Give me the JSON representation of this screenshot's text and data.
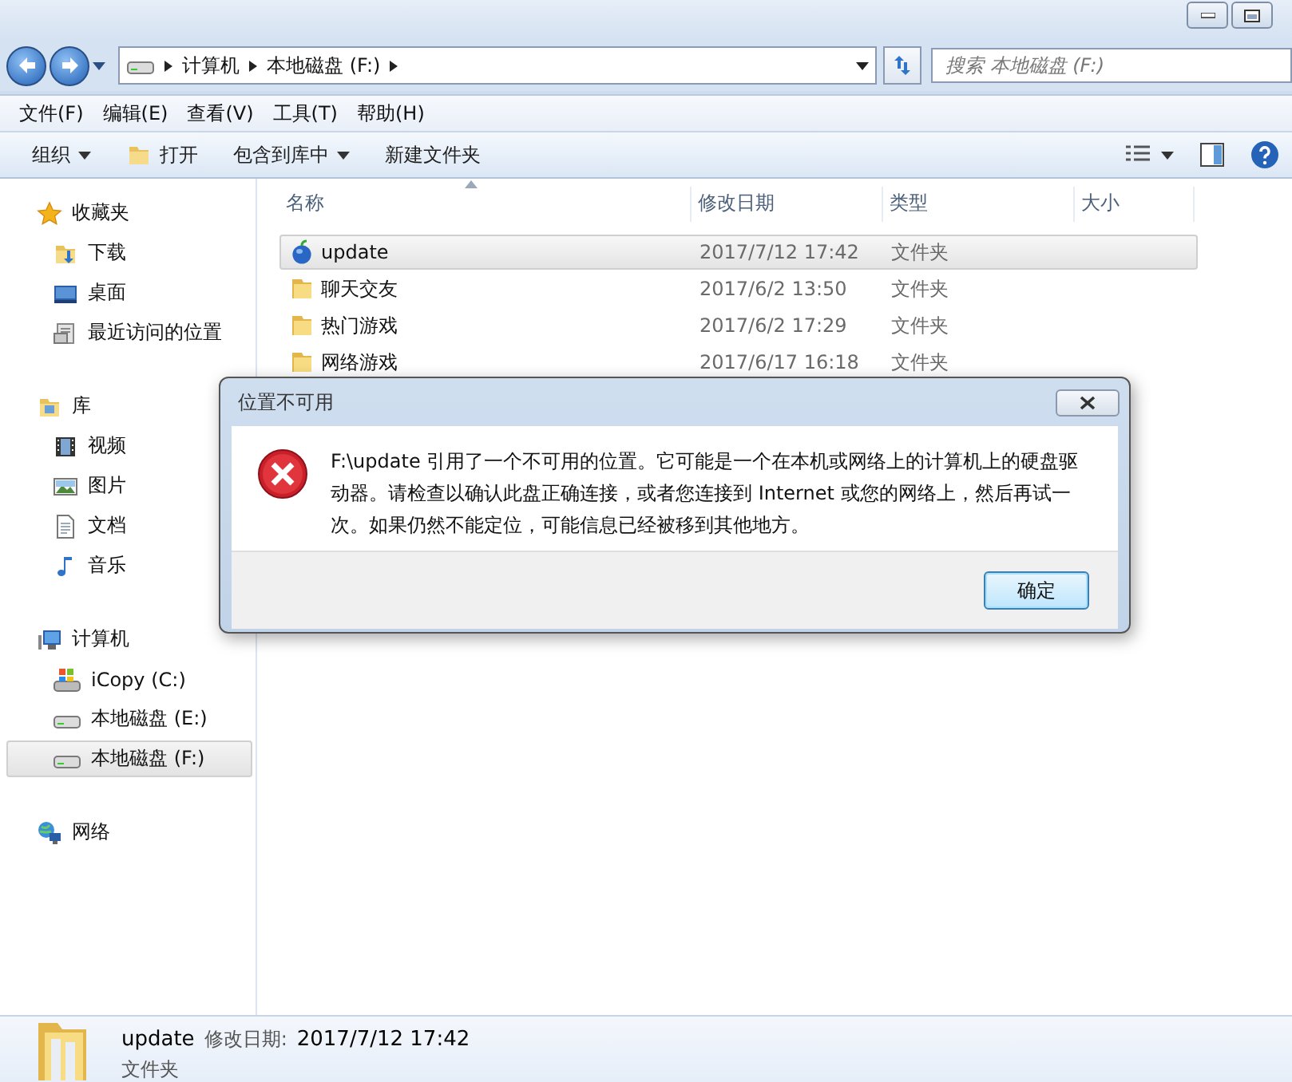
{
  "address": {
    "path": [
      "计算机",
      "本地磁盘 (F:)"
    ]
  },
  "search": {
    "placeholder": "搜索 本地磁盘 (F:)"
  },
  "menu": [
    "文件(F)",
    "编辑(E)",
    "查看(V)",
    "工具(T)",
    "帮助(H)"
  ],
  "toolbar": [
    {
      "label": "组织",
      "kind": "dropdown"
    },
    {
      "label": "打开",
      "kind": "open"
    },
    {
      "label": "包含到库中",
      "kind": "dropdown"
    },
    {
      "label": "新建文件夹",
      "kind": "plain"
    }
  ],
  "sidebar": {
    "groups": [
      {
        "label": "收藏夹",
        "kind": "star",
        "children": [
          {
            "label": "下载",
            "kind": "download",
            "selected": false
          },
          {
            "label": "桌面",
            "kind": "desktop",
            "selected": false
          },
          {
            "label": "最近访问的位置",
            "kind": "recent",
            "selected": false
          }
        ]
      },
      {
        "label": "库",
        "kind": "library",
        "children": [
          {
            "label": "视频",
            "kind": "video",
            "selected": false
          },
          {
            "label": "图片",
            "kind": "image",
            "selected": false
          },
          {
            "label": "文档",
            "kind": "document",
            "selected": false
          },
          {
            "label": "音乐",
            "kind": "music",
            "selected": false
          }
        ]
      },
      {
        "label": "计算机",
        "kind": "computer",
        "children": [
          {
            "label": "iCopy (C:)",
            "kind": "system-drive",
            "selected": false
          },
          {
            "label": "本地磁盘 (E:)",
            "kind": "drive",
            "selected": false
          },
          {
            "label": "本地磁盘 (F:)",
            "kind": "drive",
            "selected": true
          }
        ]
      },
      {
        "label": "网络",
        "kind": "network"
      }
    ]
  },
  "table": {
    "columns": [
      {
        "label": "名称",
        "sorted": true
      },
      {
        "label": "修改日期"
      },
      {
        "label": "类型"
      },
      {
        "label": "大小"
      }
    ],
    "rows": [
      {
        "name": "update",
        "date": "2017/7/12 17:42",
        "type": "文件夹",
        "kind": "app",
        "selected": true
      },
      {
        "name": "聊天交友",
        "date": "2017/6/2 13:50",
        "type": "文件夹",
        "kind": "folder",
        "selected": false
      },
      {
        "name": "热门游戏",
        "date": "2017/6/2 17:29",
        "type": "文件夹",
        "kind": "folder",
        "selected": false
      },
      {
        "name": "网络游戏",
        "date": "2017/6/17 16:18",
        "type": "文件夹",
        "kind": "folder",
        "selected": false
      }
    ]
  },
  "dialog": {
    "title": "位置不可用",
    "message": "F:\\update 引用了一个不可用的位置。它可能是一个在本机或网络上的计算机上的硬盘驱动器。请检查以确认此盘正确连接，或者您连接到 Internet 或您的网络上，然后再试一次。如果仍然不能定位，可能信息已经被移到其他地方。",
    "button": "确定"
  },
  "details": {
    "name": "update",
    "date_label": "修改日期:",
    "date": "2017/7/12 17:42",
    "type": "文件夹"
  }
}
